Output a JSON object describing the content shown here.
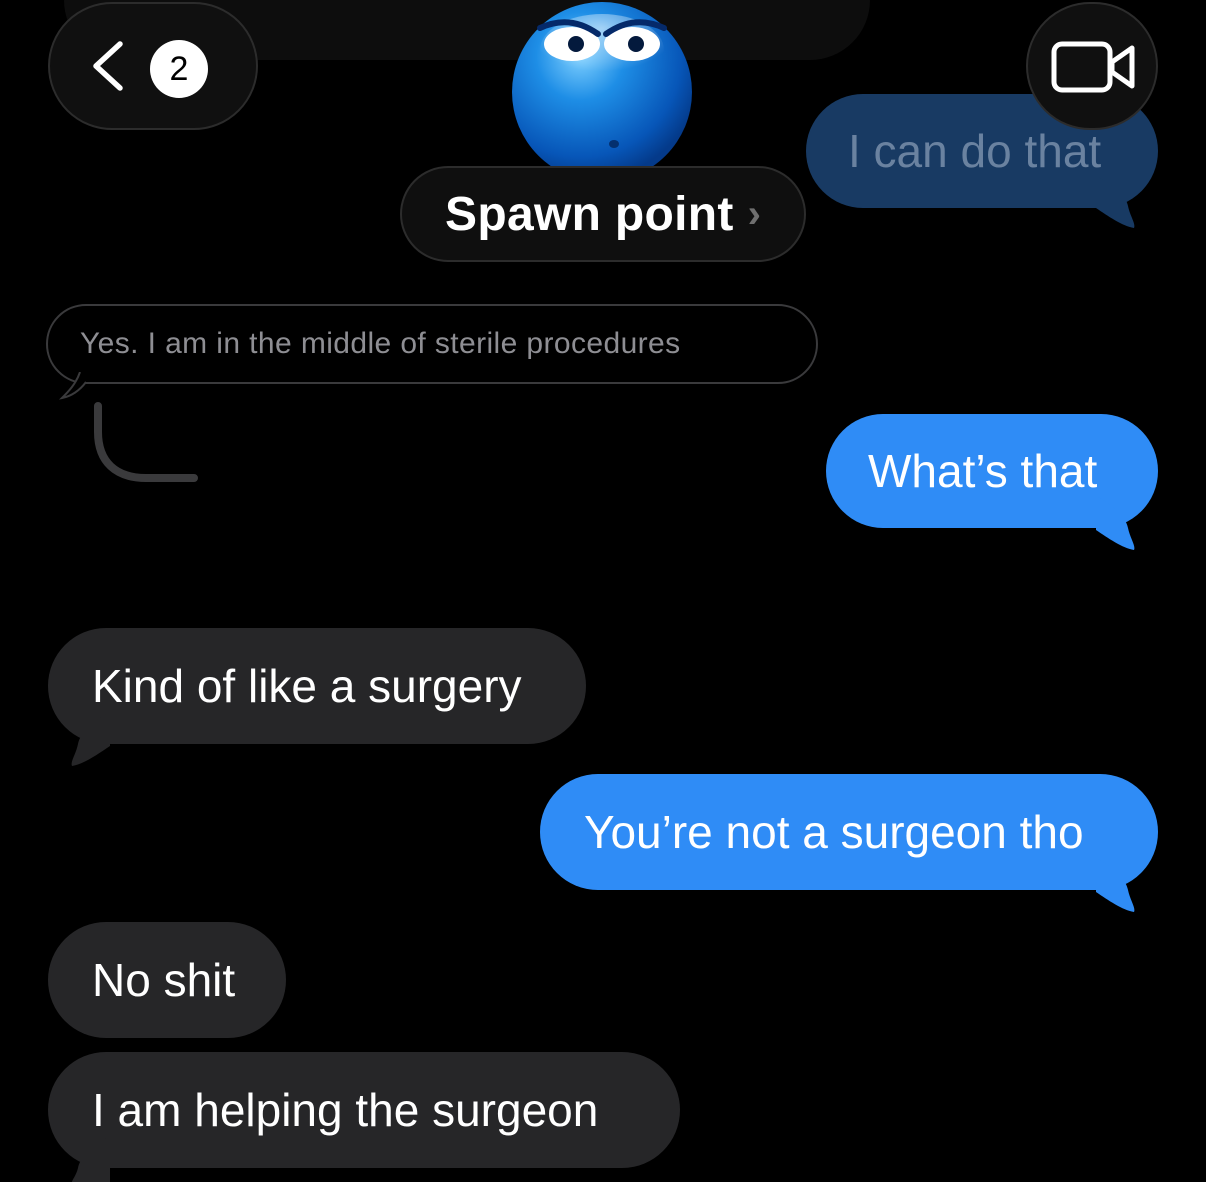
{
  "header": {
    "back_count": "2",
    "contact_name": "Spawn point",
    "name_chevron": "›"
  },
  "icons": {
    "back": "chevron-left-icon",
    "video": "video-camera-icon",
    "avatar": "blue-smiley-avatar"
  },
  "colors": {
    "background": "#000000",
    "incoming_bubble": "#262628",
    "outgoing_bubble": "#2f8cf6",
    "reply_border": "#3a3a3c"
  },
  "messages": {
    "faded": "I can do that",
    "reply_quote": "Yes.  I am in the middle of sterile procedures",
    "m1": "What’s that",
    "m2": "Kind of like a surgery",
    "m3": "You’re not a surgeon tho",
    "m4": "No shit",
    "m5": "I am helping the surgeon"
  }
}
